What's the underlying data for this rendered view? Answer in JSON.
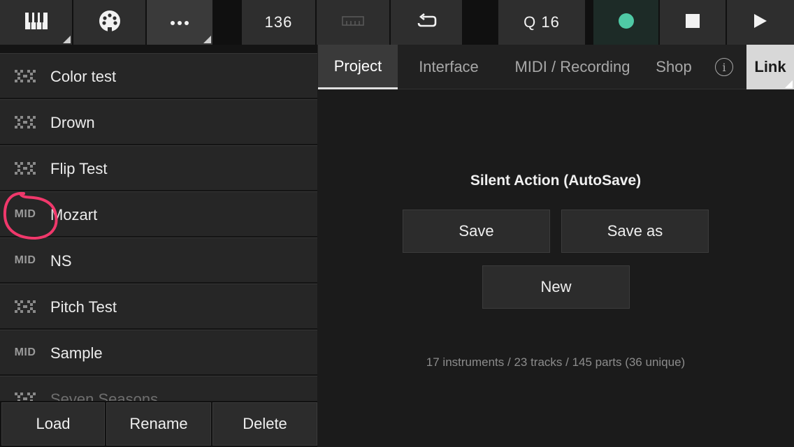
{
  "toolbar": {
    "tempo": "136",
    "quantize": "Q 16",
    "colors": {
      "record": "#4fc9a5"
    },
    "icons": [
      "piano-icon",
      "midi-connector-icon",
      "more-icon",
      "metronome-icon",
      "loop-icon",
      "record-icon",
      "stop-icon",
      "play-icon"
    ]
  },
  "projects": [
    {
      "name": "Color test",
      "kind": "audio"
    },
    {
      "name": "Drown",
      "kind": "audio"
    },
    {
      "name": "Flip Test",
      "kind": "audio"
    },
    {
      "name": "Mozart",
      "kind": "midi",
      "tag": "MID"
    },
    {
      "name": "NS",
      "kind": "midi",
      "tag": "MID"
    },
    {
      "name": "Pitch Test",
      "kind": "audio"
    },
    {
      "name": "Sample",
      "kind": "midi",
      "tag": "MID"
    },
    {
      "name": "Seven Seasons",
      "kind": "audio"
    }
  ],
  "actions": {
    "load": "Load",
    "rename": "Rename",
    "delete": "Delete"
  },
  "tabs": {
    "project": "Project",
    "interface": "Interface",
    "midi": "MIDI / Recording",
    "shop": "Shop",
    "info": "i",
    "link": "Link"
  },
  "panel": {
    "silent_action": "Silent Action (AutoSave)",
    "save": "Save",
    "save_as": "Save as",
    "new": "New",
    "stats": "17 instruments / 23 tracks / 145 parts (36 unique)"
  },
  "annotation": {
    "color": "#f0386b"
  }
}
